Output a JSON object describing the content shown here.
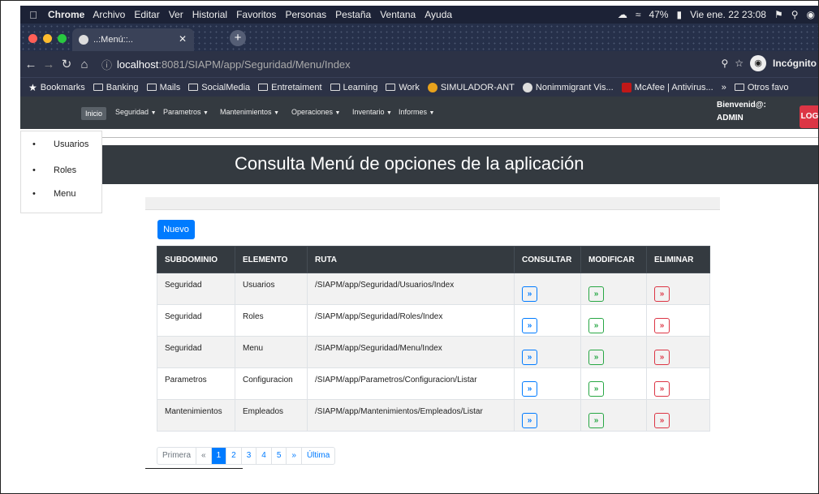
{
  "menubar": {
    "app": "Chrome",
    "items": [
      "Archivo",
      "Editar",
      "Ver",
      "Historial",
      "Favoritos",
      "Personas",
      "Pestaña",
      "Ventana",
      "Ayuda"
    ],
    "battery": "47%",
    "datetime": "Vie ene. 22 23:08"
  },
  "tab": {
    "title": "..:Menú::.."
  },
  "address": {
    "host": "localhost",
    "path": ":8081/SIAPM/app/Seguridad/Menu/Index",
    "mode": "Incógnito"
  },
  "bookmarks": {
    "items": [
      "Bookmarks",
      "Banking",
      "Mails",
      "SocialMedia",
      "Entretaiment",
      "Learning",
      "Work",
      "SIMULADOR-ANT",
      "Nonimmigrant Vis...",
      "McAfee | Antivirus...",
      "»",
      "Otros favo"
    ]
  },
  "nav": {
    "inicio": "Inicio",
    "menus": [
      "Seguridad",
      "Parametros",
      "Mantenimientos",
      "Operaciones",
      "Inventario",
      "Informes"
    ],
    "welcome_line1": "Bienvenid@:",
    "welcome_line2": "ADMIN",
    "logout": "LOG"
  },
  "dropdown": {
    "items": [
      "Usuarios",
      "Roles",
      "Menu"
    ]
  },
  "page": {
    "title": "Consulta Menú de opciones de la aplicación",
    "new_button": "Nuevo"
  },
  "table": {
    "headers": [
      "SUBDOMINIO",
      "ELEMENTO",
      "RUTA",
      "CONSULTAR",
      "MODIFICAR",
      "ELIMINAR"
    ],
    "action_glyph": "»",
    "rows": [
      {
        "subdominio": "Seguridad",
        "elemento": "Usuarios",
        "ruta": "/SIAPM/app/Seguridad/Usuarios/Index"
      },
      {
        "subdominio": "Seguridad",
        "elemento": "Roles",
        "ruta": "/SIAPM/app/Seguridad/Roles/Index"
      },
      {
        "subdominio": "Seguridad",
        "elemento": "Menu",
        "ruta": "/SIAPM/app/Seguridad/Menu/Index"
      },
      {
        "subdominio": "Parametros",
        "elemento": "Configuracion",
        "ruta": "/SIAPM/app/Parametros/Configuracion/Listar"
      },
      {
        "subdominio": "Mantenimientos",
        "elemento": "Empleados",
        "ruta": "/SIAPM/app/Mantenimientos/Empleados/Listar"
      }
    ]
  },
  "pagination": {
    "first": "Primera",
    "prev": "«",
    "pages": [
      "1",
      "2",
      "3",
      "4",
      "5"
    ],
    "next": "»",
    "last": "Última",
    "current": "1"
  }
}
